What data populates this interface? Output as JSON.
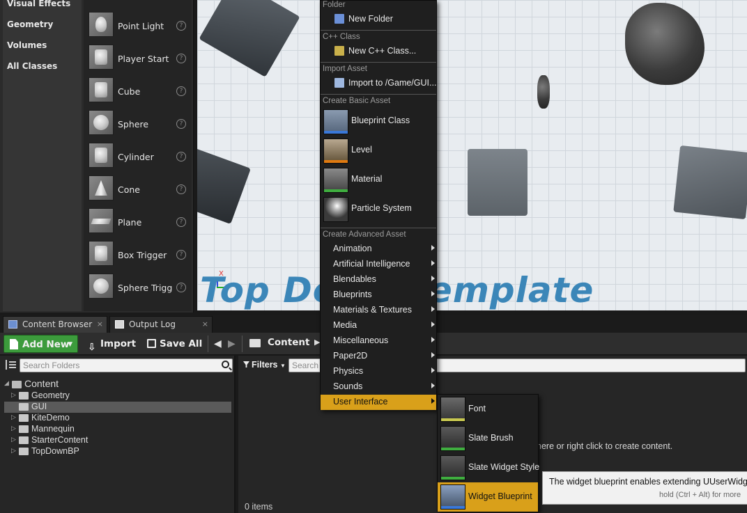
{
  "place_actors": {
    "categories": [
      "Visual Effects",
      "Geometry",
      "Volumes",
      "All Classes"
    ],
    "actors": [
      {
        "label": "Point Light",
        "icon": "point-light-icon"
      },
      {
        "label": "Player Start",
        "icon": "player-start-icon"
      },
      {
        "label": "Cube",
        "icon": "cube-icon"
      },
      {
        "label": "Sphere",
        "icon": "sphere-icon"
      },
      {
        "label": "Cylinder",
        "icon": "cylinder-icon"
      },
      {
        "label": "Cone",
        "icon": "cone-icon"
      },
      {
        "label": "Plane",
        "icon": "plane-icon"
      },
      {
        "label": "Box Trigger",
        "icon": "box-trigger-icon"
      },
      {
        "label": "Sphere Trigger",
        "icon": "sphere-trigger-icon"
      }
    ]
  },
  "viewport": {
    "overlay_text": "Top Down Template",
    "axis_label": "X"
  },
  "tabs": [
    {
      "label": "Content Browser",
      "close": "×"
    },
    {
      "label": "Output Log",
      "close": "×"
    }
  ],
  "toolbar": {
    "add_new": "Add New",
    "import": "Import",
    "save_all": "Save All",
    "breadcrumb": "Content"
  },
  "folder_tree": {
    "search_placeholder": "Search Folders",
    "root": "Content",
    "items": [
      {
        "label": "Geometry",
        "selected": false
      },
      {
        "label": "GUI",
        "selected": true
      },
      {
        "label": "KiteDemo",
        "selected": false
      },
      {
        "label": "Mannequin",
        "selected": false
      },
      {
        "label": "StarterContent",
        "selected": false
      },
      {
        "label": "TopDownBP",
        "selected": false
      }
    ]
  },
  "asset_view": {
    "filters": "Filters",
    "search_placeholder": "Search",
    "empty_hint": "here or right click to create content.",
    "item_count": "0 items"
  },
  "add_menu": {
    "folder_header": "Folder",
    "new_folder": "New Folder",
    "cpp_header": "C++ Class",
    "new_cpp": "New C++ Class...",
    "import_header": "Import Asset",
    "import_to": "Import to /Game/GUI...",
    "basic_header": "Create Basic Asset",
    "basic": [
      {
        "label": "Blueprint Class",
        "icon": "blueprint-class-icon",
        "color": "#3a78d8"
      },
      {
        "label": "Level",
        "icon": "level-icon",
        "color": "#e07a10"
      },
      {
        "label": "Material",
        "icon": "material-icon",
        "color": "#3fae3f"
      },
      {
        "label": "Particle System",
        "icon": "particle-system-icon",
        "color": "#cfcfcf"
      }
    ],
    "advanced_header": "Create Advanced Asset",
    "advanced": [
      "Animation",
      "Artificial Intelligence",
      "Blendables",
      "Blueprints",
      "Materials & Textures",
      "Media",
      "Miscellaneous",
      "Paper2D",
      "Physics",
      "Sounds",
      "User Interface"
    ],
    "active_item": "User Interface",
    "highlight_color": "#d9a01a"
  },
  "ui_submenu": [
    {
      "label": "Font",
      "icon": "font-icon"
    },
    {
      "label": "Slate Brush",
      "icon": "slate-brush-icon"
    },
    {
      "label": "Slate Widget Style",
      "icon": "slate-widget-style-icon"
    },
    {
      "label": "Widget Blueprint",
      "icon": "widget-blueprint-icon"
    }
  ],
  "tooltip": {
    "line1": "The widget blueprint enables extending UUserWidget",
    "line2": "hold (Ctrl + Alt) for more"
  }
}
